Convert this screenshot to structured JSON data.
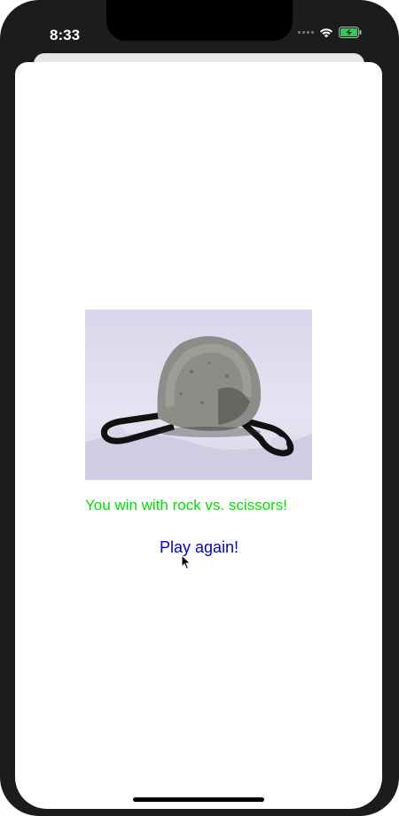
{
  "status_bar": {
    "time": "8:33",
    "signal_icon": "signal-dots-icon",
    "wifi_icon": "wifi-icon",
    "battery_icon": "battery-charging-icon"
  },
  "game": {
    "result_image_alt": "rock crushing scissors",
    "result_text": "You win with rock vs. scissors!",
    "result_color": "#00e000",
    "play_again_label": "Play again!",
    "play_again_color": "#0000d8"
  }
}
